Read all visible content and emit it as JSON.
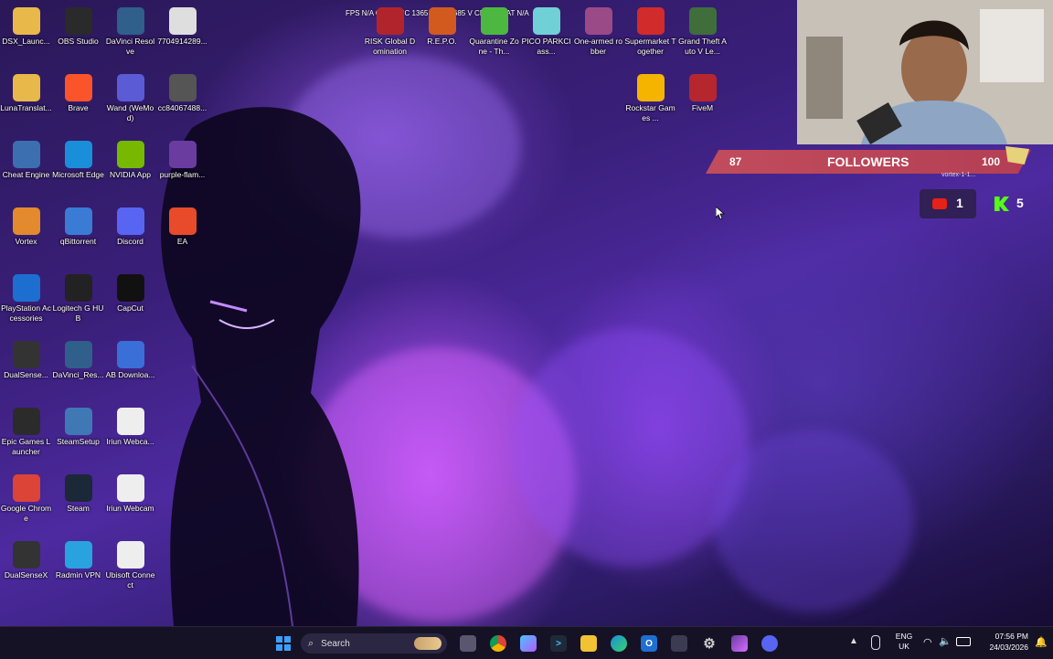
{
  "hud": {
    "text": "FPS N/A  GPU 53°C 1365 MHz 0.685 V  CPU 13  LAT N/A"
  },
  "desktop_icons": [
    {
      "label": "DSX_Launc...",
      "icon": "folder-icon",
      "color": "#e8b94a"
    },
    {
      "label": "OBS Studio",
      "icon": "obs-icon",
      "color": "#2a2a2a"
    },
    {
      "label": "DaVinci Resolve",
      "icon": "davinci-icon",
      "color": "#2f5f8a"
    },
    {
      "label": "7704914289...",
      "icon": "image-file-icon",
      "color": "#dedede"
    },
    {
      "label": "LunaTranslat...",
      "icon": "folder-icon",
      "color": "#e8b94a"
    },
    {
      "label": "Brave",
      "icon": "brave-icon",
      "color": "#fb542b"
    },
    {
      "label": "Wand (WeMod)",
      "icon": "wand-icon",
      "color": "#5b5bd6"
    },
    {
      "label": "cc84067488...",
      "icon": "image-file-icon",
      "color": "#555"
    },
    {
      "label": "Cheat Engine",
      "icon": "cheat-engine-icon",
      "color": "#3b6fb0"
    },
    {
      "label": "Microsoft Edge",
      "icon": "edge-icon",
      "color": "#1a8fd9"
    },
    {
      "label": "NVIDIA App",
      "icon": "nvidia-icon",
      "color": "#76b900"
    },
    {
      "label": "purple-flam...",
      "icon": "image-file-icon",
      "color": "#6a3ca0"
    },
    {
      "label": "Vortex",
      "icon": "vortex-icon",
      "color": "#e28a2d"
    },
    {
      "label": "qBittorrent",
      "icon": "qbittorrent-icon",
      "color": "#3a7bd5"
    },
    {
      "label": "Discord",
      "icon": "discord-icon",
      "color": "#5865f2"
    },
    {
      "label": "EA",
      "icon": "ea-icon",
      "color": "#e84b2a"
    },
    {
      "label": "PlayStation Accessories",
      "icon": "playstation-icon",
      "color": "#1c6fd1"
    },
    {
      "label": "Logitech G HUB",
      "icon": "logitech-icon",
      "color": "#222"
    },
    {
      "label": "CapCut",
      "icon": "capcut-icon",
      "color": "#111"
    },
    {
      "label": "DualSense...",
      "icon": "dualsense-icon",
      "color": "#333"
    },
    {
      "label": "DaVinci_Res...",
      "icon": "davinci-icon",
      "color": "#2f5f8a"
    },
    {
      "label": "AB Downloa...",
      "icon": "download-icon",
      "color": "#3a6fd8"
    },
    {
      "label": "Epic Games Launcher",
      "icon": "epic-icon",
      "color": "#2b2b2b"
    },
    {
      "label": "SteamSetup",
      "icon": "steam-setup-icon",
      "color": "#3f78b5"
    },
    {
      "label": "Iriun Webca...",
      "icon": "iriun-icon",
      "color": "#eeeeee"
    },
    {
      "label": "Google Chrome",
      "icon": "chrome-icon",
      "color": "#db4437"
    },
    {
      "label": "Steam",
      "icon": "steam-icon",
      "color": "#1b2838"
    },
    {
      "label": "Iriun Webcam",
      "icon": "iriun-icon",
      "color": "#eeeeee"
    },
    {
      "label": "DualSenseX",
      "icon": "dualsense-icon",
      "color": "#333"
    },
    {
      "label": "Radmin VPN",
      "icon": "radmin-icon",
      "color": "#29a3e0"
    },
    {
      "label": "Ubisoft Connect",
      "icon": "ubisoft-icon",
      "color": "#eeeeee"
    },
    {
      "label": "RISK Global Domination",
      "icon": "risk-icon",
      "color": "#b2242c"
    },
    {
      "label": "R.E.P.O.",
      "icon": "repo-icon",
      "color": "#d25a1e"
    },
    {
      "label": "Quarantine Zone - Th...",
      "icon": "quarantine-icon",
      "color": "#4db83f"
    },
    {
      "label": "PICO PARKClass...",
      "icon": "pico-park-icon",
      "color": "#6fd1d6"
    },
    {
      "label": "One-armed robber",
      "icon": "robber-icon",
      "color": "#9b4a88"
    },
    {
      "label": "Supermarket Together",
      "icon": "supermarket-icon",
      "color": "#d12b2b"
    },
    {
      "label": "Grand Theft Auto V Le...",
      "icon": "gta-icon",
      "color": "#3f6e3a"
    },
    {
      "label": "Rockstar Games ...",
      "icon": "rockstar-icon",
      "color": "#f5b400"
    },
    {
      "label": "FiveM",
      "icon": "fivem-icon",
      "color": "#b5262f"
    }
  ],
  "stream_overlay": {
    "followers_current": "87",
    "followers_label": "FOLLOWERS",
    "followers_goal": "100",
    "followers_fraction": 0.87,
    "small_caption": "vortex-1-1...",
    "youtube_count": "1",
    "kick_count": "5"
  },
  "taskbar": {
    "search_placeholder": "Search",
    "language": "ENG",
    "region": "UK",
    "time": "07:56 PM",
    "date": "24/03/2026",
    "pinned": [
      "start-icon",
      "search-icon",
      "task-view-icon",
      "chrome-icon",
      "copilot-icon",
      "terminal-icon",
      "file-explorer-icon",
      "edge-icon",
      "outlook-icon",
      "store-icon",
      "settings-icon",
      "wallpaper-icon",
      "discord-icon"
    ]
  }
}
